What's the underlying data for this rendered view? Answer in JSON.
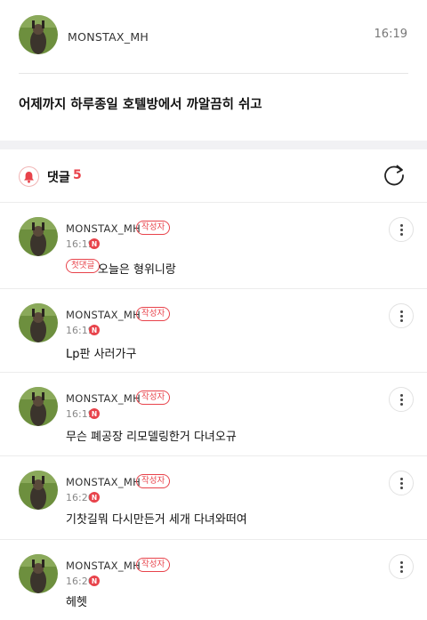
{
  "post": {
    "author": "MONSTAX_MH",
    "time": "16:19",
    "body": "어제까지 하루종일 호텔방에서 까알끔히 쉬고"
  },
  "comments_header": {
    "title": "댓글",
    "count": "5",
    "bell_icon": "bell-icon",
    "refresh_icon": "refresh-icon"
  },
  "comments": [
    {
      "author": "MONSTAX_MH",
      "badge": "작성자",
      "time": "16:19",
      "new_badge": "N",
      "first_badge": "첫댓글",
      "text": "오늘은 형위니랑"
    },
    {
      "author": "MONSTAX_MH",
      "badge": "작성자",
      "time": "16:19",
      "new_badge": "N",
      "text": "Lp판 사러가구"
    },
    {
      "author": "MONSTAX_MH",
      "badge": "작성자",
      "time": "16:19",
      "new_badge": "N",
      "text": "무슨 폐공장 리모델링한거 다녀오규"
    },
    {
      "author": "MONSTAX_MH",
      "badge": "작성자",
      "time": "16:20",
      "new_badge": "N",
      "text": "기찻길뭐 다시만든거 세개 다녀와떠여"
    },
    {
      "author": "MONSTAX_MH",
      "badge": "작성자",
      "time": "16:20",
      "new_badge": "N",
      "text": "헤헷"
    }
  ],
  "colors": {
    "accent": "#e8434b",
    "divider": "#ececec",
    "section_gap": "#f1f1f4"
  }
}
